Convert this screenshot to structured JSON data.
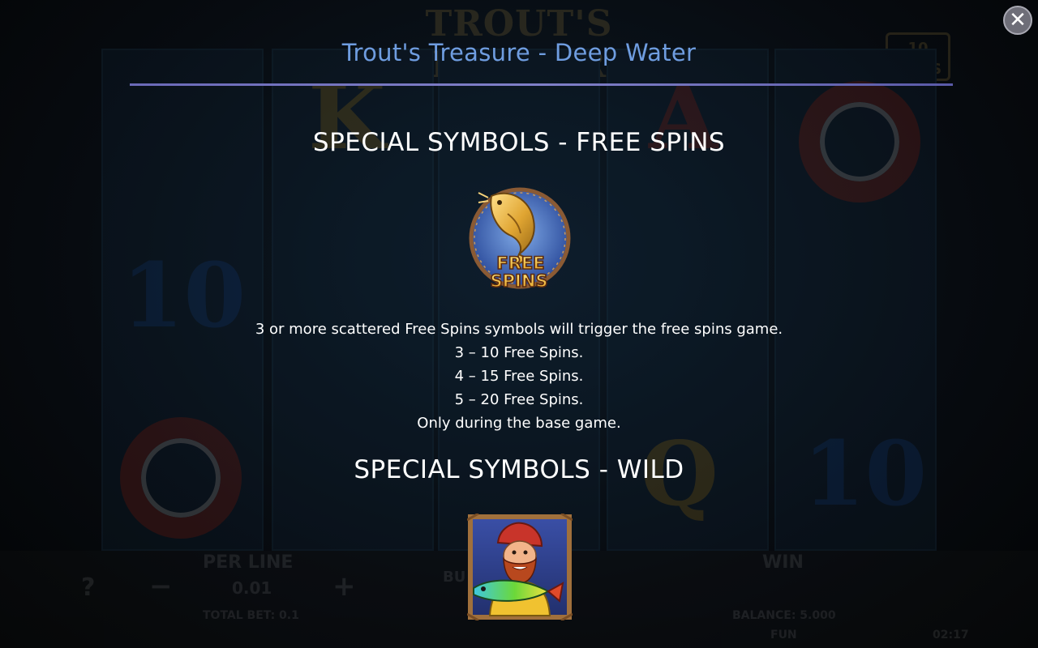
{
  "background": {
    "game_logo": "TROUT'S TREASURE",
    "lines_badge": "10 LINES",
    "per_line_label": "PER LINE",
    "per_line_value": "0.01",
    "total_bet": "TOTAL BET: 0.1",
    "win_label": "WIN",
    "balance": "BALANCE: 5.000",
    "currency": "FUN",
    "buy_label": "BU",
    "time": "02:17"
  },
  "paytable": {
    "title": "Trout's Treasure - Deep Water",
    "close_icon": "close-icon",
    "free_spins": {
      "heading": "SPECIAL SYMBOLS - FREE SPINS",
      "symbol_text_1": "FREE",
      "symbol_text_2": "SPINS",
      "lines": [
        "3 or more scattered Free Spins symbols will trigger the free spins game.",
        "3 – 10 Free Spins.",
        "4 – 15 Free Spins.",
        "5 – 20 Free Spins.",
        "Only during the base game."
      ]
    },
    "wild": {
      "heading": "SPECIAL SYMBOLS - WILD"
    }
  },
  "colors": {
    "title": "#6f9de0",
    "rule": "#7a7ac4",
    "gold": "#e0a532",
    "frame_blue": "#3d5fb0"
  }
}
